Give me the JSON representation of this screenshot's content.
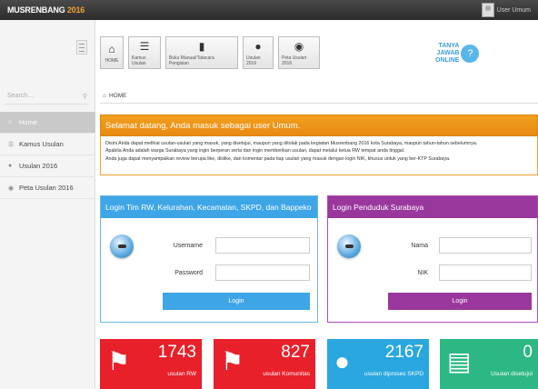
{
  "topbar": {
    "brand": "MUSRENBANG",
    "year": "2016",
    "user": "User Umum"
  },
  "sidebar": {
    "search_placeholder": "Search...",
    "items": [
      {
        "label": "Home",
        "icon": "home-icon",
        "active": true
      },
      {
        "label": "Kamus Usulan",
        "icon": "list-icon",
        "active": false
      },
      {
        "label": "Usulan 2016",
        "icon": "chat-icon",
        "active": false
      },
      {
        "label": "Peta Usulan 2016",
        "icon": "map-pin-icon",
        "active": false
      }
    ]
  },
  "toolbar": {
    "buttons": [
      {
        "label": "HOME",
        "icon": "home-icon"
      },
      {
        "label": "Kamus Usulan",
        "icon": "list-icon"
      },
      {
        "label": "Buku Manual/Tatacara Pengisian",
        "icon": "book-icon"
      },
      {
        "label": "Usulan 2016",
        "icon": "chat-icon"
      },
      {
        "label": "Peta Usulan 2016",
        "icon": "map-pin-icon"
      }
    ]
  },
  "tanya": {
    "line1": "TANYA",
    "line2": "JAWAB",
    "line3": "ONLINE"
  },
  "breadcrumb": "HOME",
  "welcome": {
    "title": "Selamat datang, Anda masuk sebagai user Umum.",
    "line1": "Disini Anda dapat melihat usulan-usulan yang masuk, yang disetujui, maupun yang ditolak pada kegiatan Musrenbang 2016 kota Surabaya, maupun tahun-tahun sebelumnya.",
    "line2": "Apabila Anda adalah warga Surabaya yang ingin berperan serta dan ingin memberikan usulan, dapat melalui ketua RW tempat anda tinggal.",
    "line3": "Anda juga dapat menyampaikan review berupa like, dislike, dan komentar pada tiap usulan yang masuk dengan login NIK, khusus untuk yang ber-KTP Surabaya."
  },
  "login_rw": {
    "title": "Login Tim RW, Kelurahan, Kecamatan, SKPD, dan Bappeko",
    "username_label": "Username",
    "password_label": "Password",
    "username_value": "",
    "password_value": "",
    "button": "Login"
  },
  "login_penduduk": {
    "title": "Login Penduduk Surabaya",
    "nama_label": "Nama",
    "nik_label": "NIK",
    "nama_value": "",
    "nik_value": "",
    "button": "Login"
  },
  "stats": [
    {
      "value": "1743",
      "label": "usulan RW",
      "color": "#e8202a",
      "icon": "megaphone-icon"
    },
    {
      "value": "827",
      "label": "usulan Komunitas",
      "color": "#e8202a",
      "icon": "megaphone-icon"
    },
    {
      "value": "2167",
      "label": "usulan diproses SKPD",
      "color": "#2aa7df",
      "icon": "chat-icon"
    },
    {
      "value": "0",
      "label": "Usulan disetujui",
      "color": "#2db883",
      "icon": "cart-icon"
    }
  ],
  "colors": {
    "orange": "#f2a01e",
    "blue": "#3ea6e6",
    "purple": "#9a379c",
    "red": "#e8202a",
    "green": "#2db883"
  }
}
